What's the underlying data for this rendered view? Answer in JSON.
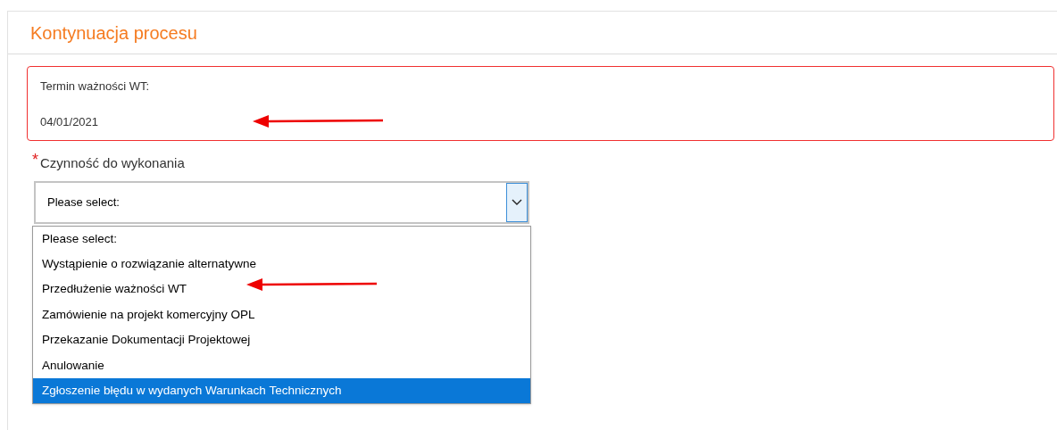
{
  "panel": {
    "title": "Kontynuacja procesu"
  },
  "expiry": {
    "label": "Termin ważności WT:",
    "value": "04/01/2021"
  },
  "activity": {
    "label": "Czynność do wykonania",
    "required_mark": "*",
    "value": "Please select:",
    "options": [
      {
        "label": "Please select:",
        "highlighted": false
      },
      {
        "label": "Wystąpienie o rozwiązanie alternatywne",
        "highlighted": false
      },
      {
        "label": "Przedłużenie ważności WT",
        "highlighted": false
      },
      {
        "label": "Zamówienie na projekt komercyjny OPL",
        "highlighted": false
      },
      {
        "label": "Przekazanie Dokumentacji Projektowej",
        "highlighted": false
      },
      {
        "label": "Anulowanie",
        "highlighted": false
      },
      {
        "label": "Zgłoszenie błędu w wydanych Warunkach Technicznych",
        "highlighted": true
      }
    ]
  }
}
